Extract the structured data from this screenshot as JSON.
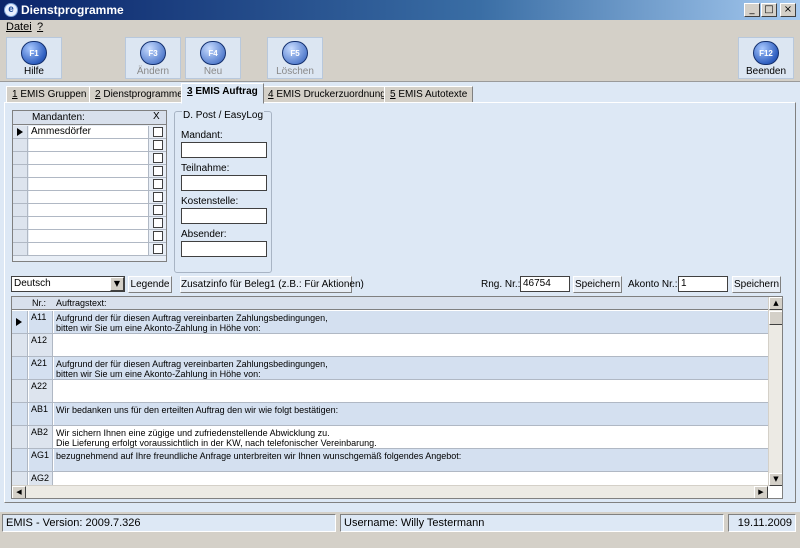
{
  "window": {
    "title": "Dienstprogramme",
    "icon": "app-e-icon",
    "min": "_",
    "max": "□",
    "close": "×"
  },
  "menu": {
    "items": [
      "Datei",
      "?"
    ]
  },
  "toolbar": {
    "buttons": [
      {
        "key": "F1",
        "label": "Hilfe",
        "enabled": true
      },
      {
        "key": "F3",
        "label": "Ändern",
        "enabled": false
      },
      {
        "key": "F4",
        "label": "Neu",
        "enabled": false
      },
      {
        "key": "F5",
        "label": "Löschen",
        "enabled": false
      },
      {
        "key": "F12",
        "label": "Beenden",
        "enabled": true
      }
    ]
  },
  "tabs": [
    {
      "num": "1",
      "label": " EMIS Gruppen"
    },
    {
      "num": "2",
      "label": " Dienstprogramme"
    },
    {
      "num": "3",
      "label": " EMIS Auftrag",
      "active": true
    },
    {
      "num": "4",
      "label": " EMIS Druckerzuordnung"
    },
    {
      "num": "5",
      "label": " EMIS Autotexte"
    }
  ],
  "mandanten": {
    "header": "Mandanten:",
    "check_header": "X",
    "rows": [
      "Ammesdörfer",
      "",
      "",
      "",
      "",
      "",
      "",
      "",
      "",
      ""
    ]
  },
  "post": {
    "title": "D. Post / EasyLog",
    "fields": [
      {
        "label": "Mandant:",
        "value": ""
      },
      {
        "label": "Teilnahme:",
        "value": ""
      },
      {
        "label": "Kostenstelle:",
        "value": ""
      },
      {
        "label": "Absender:",
        "value": ""
      }
    ]
  },
  "controls": {
    "language": "Deutsch",
    "legende": "Legende",
    "zusatzinfo": "Zusatzinfo für Beleg1 (z.B.: Für Aktionen)",
    "rng_label": "Rng. Nr.:",
    "rng_value": "46754",
    "save1": "Speichern",
    "akonto_label": "Akonto Nr.:",
    "akonto_value": "1",
    "save2": "Speichern"
  },
  "auftrag": {
    "header_nr": "Nr.:",
    "header_text": "Auftragstext:",
    "rows": [
      {
        "nr": "A11",
        "text": "Aufgrund der für diesen Auftrag vereinbarten Zahlungsbedingungen,\nbitten wir Sie um eine Akonto-Zahlung in Höhe von:"
      },
      {
        "nr": "A12",
        "text": ""
      },
      {
        "nr": "A21",
        "text": "Aufgrund der für diesen Auftrag vereinbarten Zahlungsbedingungen,\nbitten wir Sie um eine Akonto-Zahlung in Höhe von:"
      },
      {
        "nr": "A22",
        "text": ""
      },
      {
        "nr": "AB1",
        "text": "Wir bedanken uns für den erteilten Auftrag den wir wie folgt bestätigen:"
      },
      {
        "nr": "AB2",
        "text": "Wir sichern Ihnen eine zügige und zufriedenstellende Abwicklung zu.\nDie Lieferung erfolgt voraussichtlich in der   KW, nach telefonischer Vereinbarung."
      },
      {
        "nr": "AG1",
        "text": "bezugnehmend auf Ihre freundliche Anfrage unterbreiten wir Ihnen wunschgemäß folgendes Angebot:"
      },
      {
        "nr": "AG2",
        "text": ""
      }
    ]
  },
  "status": {
    "version": "EMIS - Version: 2009.7.326",
    "user": "Username: Willy Testermann",
    "date": "19.11.2009"
  }
}
